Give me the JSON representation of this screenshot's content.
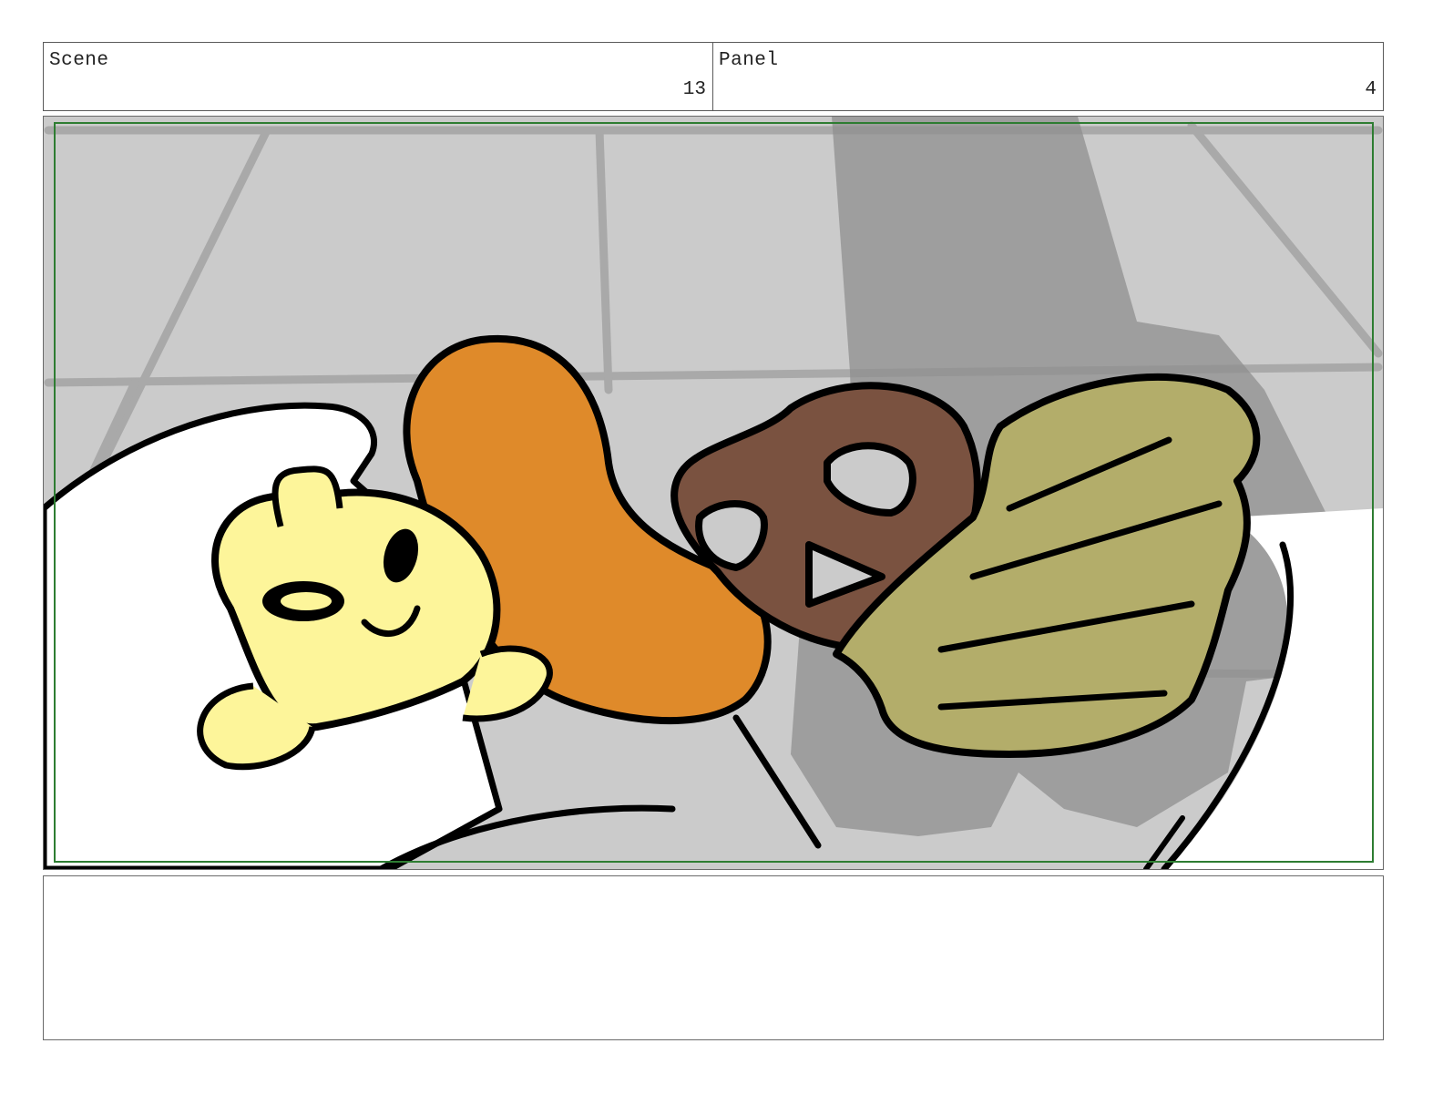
{
  "header": {
    "scene_label": "Scene",
    "scene_number": "13",
    "panel_label": "Panel",
    "panel_number": "4"
  },
  "colors": {
    "floor": "#cbcbcb",
    "tile_lines": "#a9a9a9",
    "shadow": "#8f8f8f",
    "skin": "#fdf59a",
    "hair": "#df8a2a",
    "pretzel": "#7a5240",
    "hat": "#b3ad6a",
    "safe_frame": "#2e7d32",
    "ink": "#000000"
  },
  "icons": [
    "storyboard-drawing"
  ],
  "notes": ""
}
